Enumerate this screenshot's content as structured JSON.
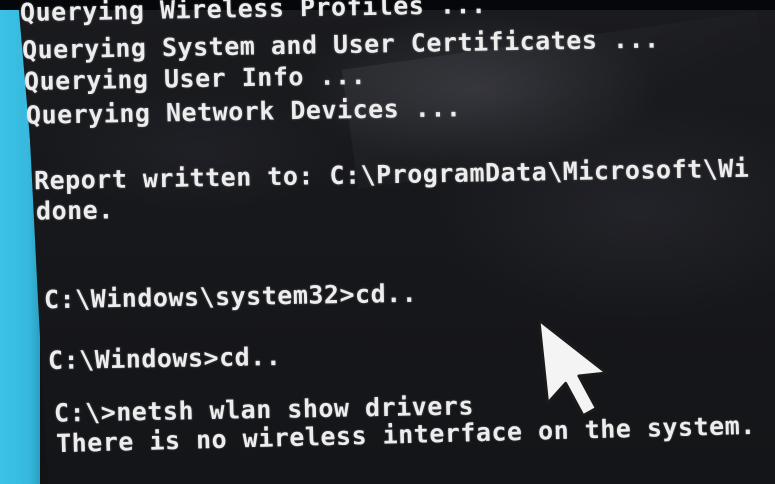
{
  "console": {
    "lines": [
      "Querying Wireless Profiles ...",
      "Querying System and User Certificates ...",
      "Querying User Info ...",
      "Querying Network Devices ...",
      "Report written to: C:\\ProgramData\\Microsoft\\Wi",
      "done.",
      "C:\\Windows\\system32>cd..",
      "C:\\Windows>cd..",
      "C:\\>netsh wlan show drivers",
      "There is no wireless interface on the system."
    ]
  },
  "colors": {
    "console_background": "#161719",
    "console_text": "#ededed",
    "desktop_accent": "#3cc2e6"
  },
  "icons": {
    "pointer": "mouse-pointer-icon"
  }
}
